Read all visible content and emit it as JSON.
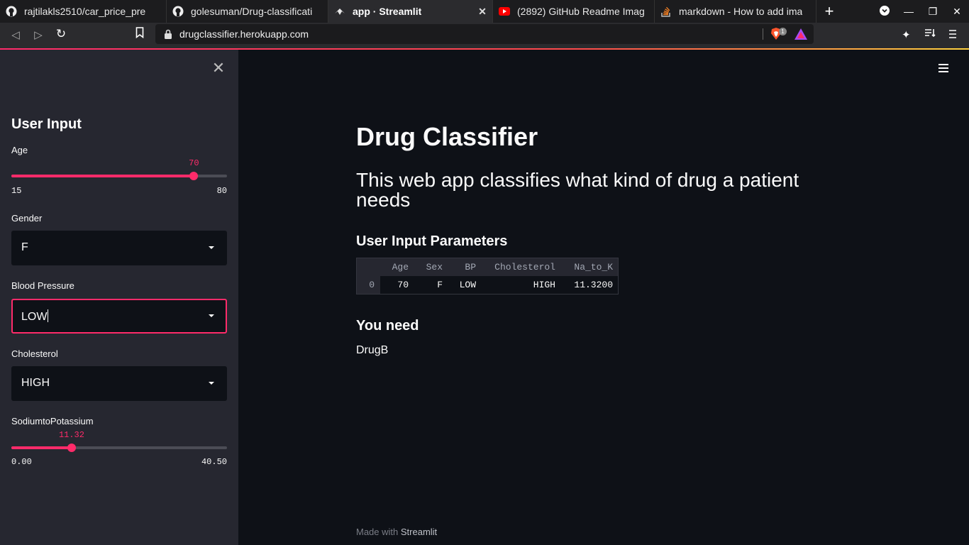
{
  "browser": {
    "tabs": [
      {
        "title": "rajtilakls2510/car_price_pre",
        "icon": "github-icon",
        "active": false
      },
      {
        "title": "golesuman/Drug-classificati",
        "icon": "github-icon",
        "active": false
      },
      {
        "title": "app · Streamlit",
        "icon": "streamlit-icon",
        "active": true
      },
      {
        "title": "(2892) GitHub Readme Imag",
        "icon": "youtube-icon",
        "active": false
      },
      {
        "title": "markdown - How to add ima",
        "icon": "stackoverflow-icon",
        "active": false
      }
    ],
    "url": "drugclassifier.herokuapp.com",
    "brave_badge": "1"
  },
  "sidebar": {
    "title": "User Input",
    "age": {
      "label": "Age",
      "value": "70",
      "min": "15",
      "max": "80",
      "fraction": 0.846
    },
    "gender": {
      "label": "Gender",
      "value": "F"
    },
    "bp": {
      "label": "Blood Pressure",
      "value": "LOW"
    },
    "cholesterol": {
      "label": "Cholesterol",
      "value": "HIGH"
    },
    "na_to_k": {
      "label": "SodiumtoPotassium",
      "value": "11.32",
      "min": "0.00",
      "max": "40.50",
      "fraction": 0.2795
    }
  },
  "main": {
    "title": "Drug Classifier",
    "subtitle": "This web app classifies what kind of drug a patient needs",
    "params_heading": "User Input Parameters",
    "table": {
      "columns": [
        "Age",
        "Sex",
        "BP",
        "Cholesterol",
        "Na_to_K"
      ],
      "rows": [
        {
          "index": "0",
          "cells": [
            "70",
            "F",
            "LOW",
            "HIGH",
            "11.3200"
          ]
        }
      ]
    },
    "result_heading": "You need",
    "result": "DrugB"
  },
  "footer": {
    "prefix": "Made with",
    "brand": "Streamlit"
  },
  "colors": {
    "accent": "#ff2b6a",
    "sidebar_bg": "#262730",
    "main_bg": "#0e1117"
  }
}
